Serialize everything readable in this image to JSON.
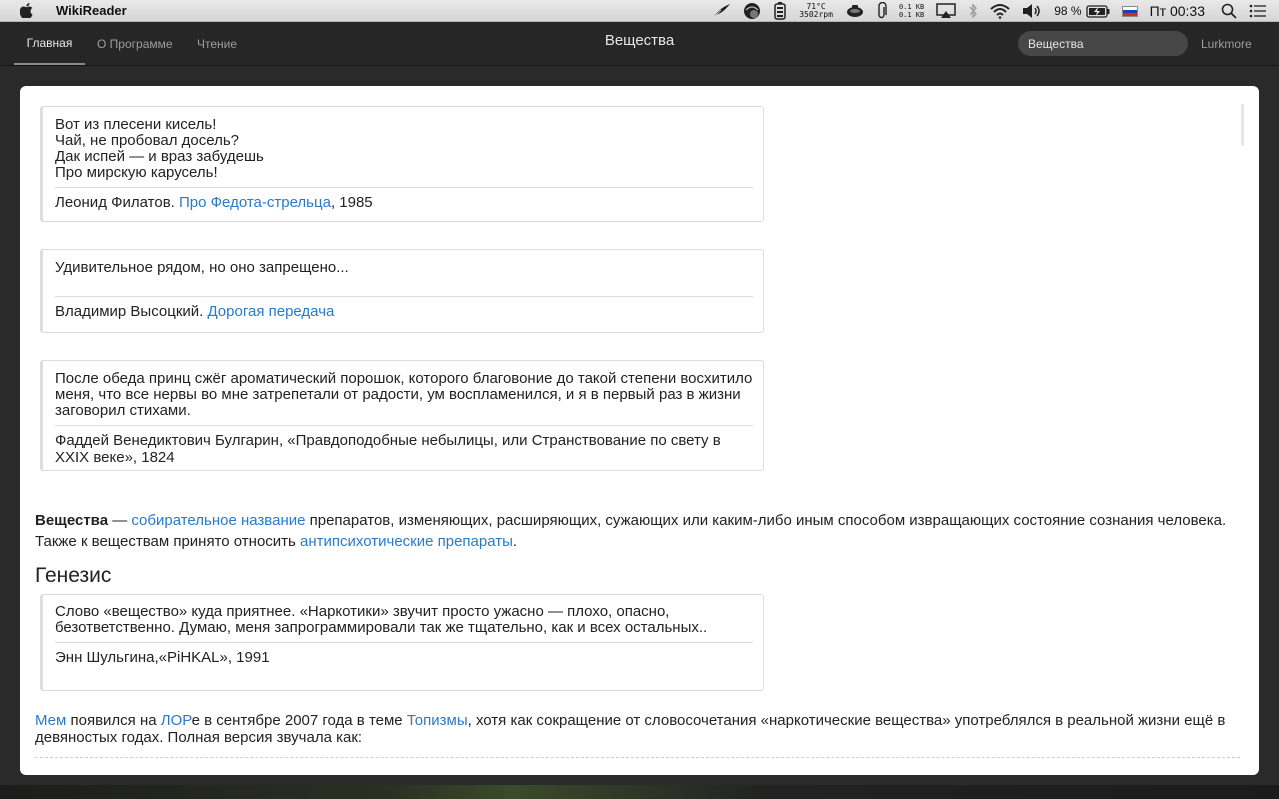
{
  "menubar": {
    "app_name": "WikiReader",
    "icons": [
      "apple-icon",
      "feather-icon",
      "helmet-icon",
      "battery-monitor-icon",
      "teapot-icon",
      "paperclip-icon",
      "airplay-icon",
      "bluetooth-icon",
      "wifi-icon",
      "volume-icon",
      "battery-icon",
      "russian-flag-icon",
      "search-icon",
      "list-icon"
    ],
    "temp_line1": "71°C",
    "temp_line2": "3502rpm",
    "net_line1": "0.1 KB",
    "net_line2": "0.1 KB",
    "battery_pct": "98 %",
    "clock": "Пт 00:33"
  },
  "toolbar": {
    "tabs": [
      {
        "label": "Главная"
      },
      {
        "label": "О Программе"
      },
      {
        "label": "Чтение"
      }
    ],
    "title": "Вещества",
    "search_value": "Вещества",
    "site_link": "Lurkmore"
  },
  "quotes": [
    {
      "lines": [
        "Вот из плесени кисель!",
        "Чай, не пробовал досель?",
        "Дак испей — и враз забудешь",
        "Про мирскую карусель!"
      ],
      "attr_prefix": "Леонид Филатов. ",
      "attr_link": "Про Федота-стрельца",
      "attr_suffix": ", 1985"
    },
    {
      "lines": [
        "Удивительное рядом, но оно запрещено..."
      ],
      "attr_prefix": "Владимир Высоцкий. ",
      "attr_link": "Дорогая передача"
    },
    {
      "text": "После обеда принц сжёг ароматический порошок, которого благовоние до такой степени восхитило меня, что все нервы во мне затрепетали от радости, ум воспламенился, и я в первый раз в жизни заговорил стихами.",
      "attr": "Фаддей Венедиктович Булгарин, «Правдоподобные небылицы, или Странствование по свету в XXIX веке», 1824"
    },
    {
      "text": "Слово «вещество» куда приятнее. «Наркотики» звучит просто ужасно — плохо, опасно, безответственно. Думаю, меня запрограммировали так же тщательно, как и всех остальных..",
      "attr": "Энн Шульгина,«PiHKAL», 1991"
    }
  ],
  "intro": {
    "term": "Вещества",
    "dash": " — ",
    "link1": "собирательное название",
    "text1": " препаратов, изменяющих, расширяющих, сужающих или каким-либо иным способом извращающих состояние сознания человека. Также к веществам принято относить ",
    "link2": "антипсихотические препараты",
    "text2": "."
  },
  "heading": "Генезис",
  "genesis": {
    "link1": "Мем",
    "text1": " появился на ",
    "link2": "ЛОР",
    "text2": "е в сентябре 2007 года в теме ",
    "link3": "Топизмы",
    "text3": ", хотя как сокращение от словосочетания «наркотические вещества» употреблялся в реальной жизни ещё в девяностых годах. Полная версия звучала как:"
  },
  "colors": {
    "link": "#2a7ac8",
    "toolbar_bg": "#262626",
    "content_bg": "#ffffff"
  }
}
